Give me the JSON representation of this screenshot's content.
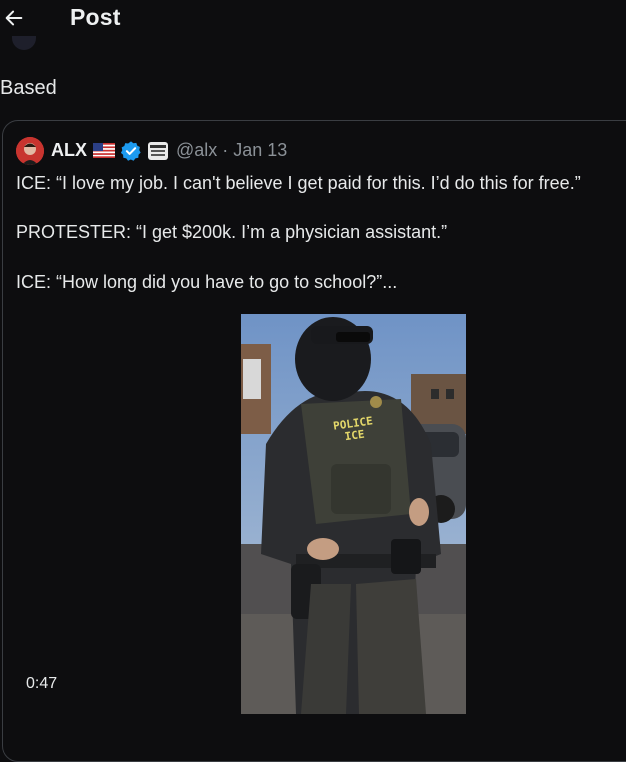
{
  "header": {
    "back_icon": "arrow-left-icon",
    "title": "Post"
  },
  "post": {
    "text": "Based"
  },
  "quote": {
    "author_name": "ALX",
    "flag_icon": "us-flag-icon",
    "verified_icon": "verified-badge-icon",
    "affiliate_icon": "affiliate-badge-icon",
    "handle_date": "@alx · Jan 13",
    "lines": [
      "ICE: “I love my job. I can't believe I get paid for this. I’d do this for free.”",
      "PROTESTER: “I get $200k. I’m a physician assistant.”",
      "ICE: “How long did you have to go to school?”..."
    ],
    "media": {
      "vest_label_1": "POLICE",
      "vest_label_2": "ICE",
      "duration": "0:47"
    }
  },
  "colors": {
    "background": "#0d0d0f",
    "text": "#e7e9ea",
    "muted": "#8b9197",
    "verified": "#1d9bf0"
  }
}
